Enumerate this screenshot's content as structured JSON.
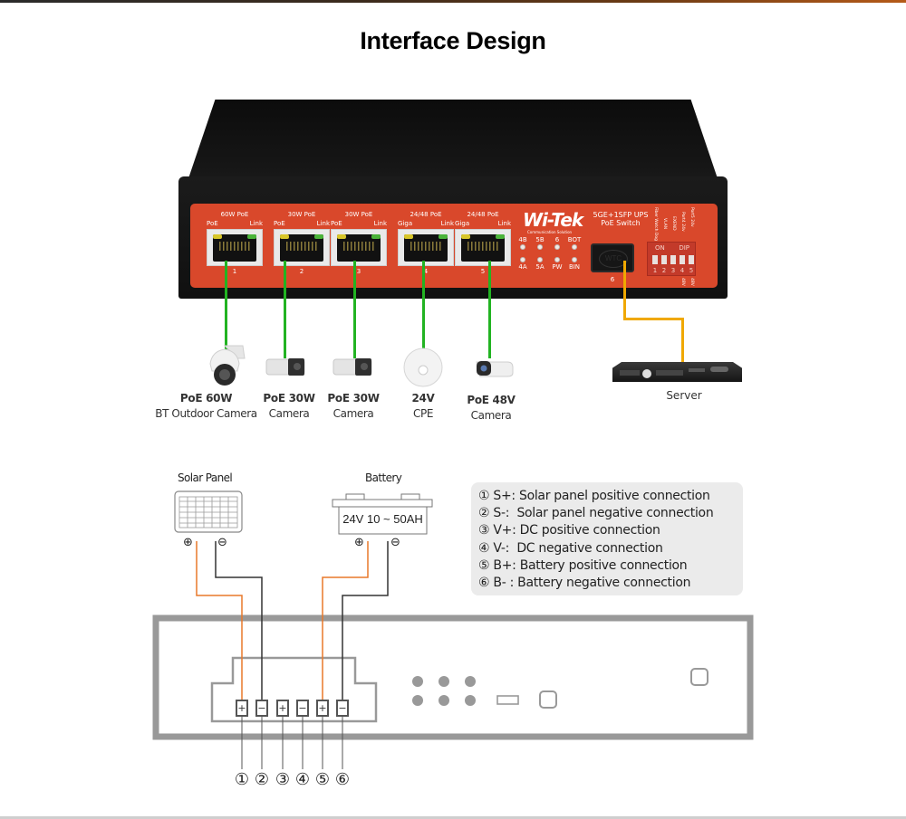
{
  "page": {
    "title": "Interface Design"
  },
  "switch": {
    "brand": "Wi-Tek",
    "brand_subtitle": "Communication Solution",
    "model_line1": "5GE+1SFP UPS",
    "model_line2": "PoE Switch",
    "panel_color": "#d9482b",
    "ports": [
      {
        "header": "60W PoE",
        "left_label": "PoE",
        "right_label": "Link",
        "number": "1"
      },
      {
        "header": "30W PoE",
        "left_label": "PoE",
        "right_label": "Link",
        "number": "2"
      },
      {
        "header": "30W PoE",
        "left_label": "PoE",
        "right_label": "Link",
        "number": "3"
      },
      {
        "header": "24/48 PoE",
        "left_label": "Giga",
        "right_label": "Link",
        "number": "4"
      },
      {
        "header": "24/48 PoE",
        "left_label": "Giga",
        "right_label": "Link",
        "number": "5"
      }
    ],
    "status_leds": {
      "top": [
        "4B",
        "5B",
        "6",
        "BOT"
      ],
      "bottom": [
        "4A",
        "5A",
        "PW",
        "BIN"
      ]
    },
    "sfp": {
      "label": "WTC",
      "number": "6"
    },
    "dip": {
      "on_label": "ON",
      "dip_label": "DIP",
      "switch_numbers": [
        "1",
        "2",
        "3",
        "4",
        "5"
      ],
      "functions": [
        "Fiber Watch Dog",
        "VLAN",
        "EXEND",
        "Port4 24v",
        "Port5 24v"
      ],
      "alt_labels": [
        "48V",
        "48V"
      ]
    }
  },
  "devices": [
    {
      "line1": "PoE 60W",
      "line2": "BT Outdoor Camera",
      "icon": "ptz-dome-camera-icon"
    },
    {
      "line1": "PoE 30W",
      "line2": "Camera",
      "icon": "bullet-camera-icon"
    },
    {
      "line1": "PoE 30W",
      "line2": "Camera",
      "icon": "bullet-camera-icon"
    },
    {
      "line1": "24V",
      "line2": "CPE",
      "icon": "cpe-antenna-icon"
    },
    {
      "line1": "PoE 48V",
      "line2": "Camera",
      "icon": "bullet-camera-icon"
    }
  ],
  "server": {
    "label": "Server",
    "icon": "rack-server-icon"
  },
  "wiring": {
    "solar_panel_label": "Solar Panel",
    "battery_label": "Battery",
    "battery_spec": "24V 10 ~ 50AH",
    "plus_symbol": "⊕",
    "minus_symbol": "⊖",
    "terminal_signs": [
      "+",
      "−",
      "+",
      "−",
      "+",
      "−"
    ],
    "terminal_numbers": [
      "①",
      "②",
      "③",
      "④",
      "⑤",
      "⑥"
    ],
    "legend": [
      "① S+: Solar panel positive connection",
      "② S-:  Solar panel negative connection",
      "③ V+: DC positive connection",
      "④ V-:  DC negative connection",
      "⑤ B+: Battery positive connection",
      "⑥ B- : Battery negative connection"
    ],
    "colors": {
      "positive_wire": "#e8782a",
      "negative_wire": "#333333",
      "outline": "#999999"
    }
  },
  "cables": {
    "poe_color": "#22b322",
    "uplink_color": "#f0a800"
  }
}
